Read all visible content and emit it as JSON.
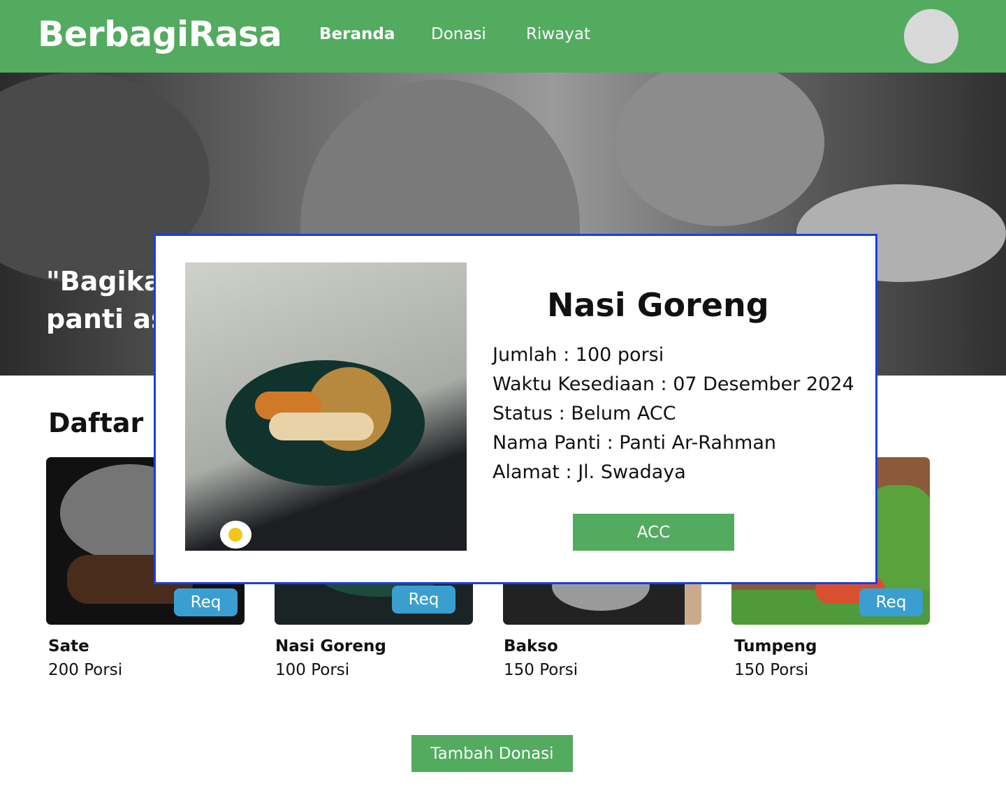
{
  "navbar": {
    "brand": "BerbagiRasa",
    "links": [
      {
        "label": "Beranda",
        "active": true
      },
      {
        "label": "Donasi",
        "active": false
      },
      {
        "label": "Riwayat",
        "active": false
      }
    ]
  },
  "hero": {
    "line1": "\"Bagika",
    "line2": "panti as"
  },
  "section": {
    "title": "Daftar M"
  },
  "cards": [
    {
      "name": "Sate",
      "qty": "200 Porsi",
      "button": "Req"
    },
    {
      "name": "Nasi Goreng",
      "qty": "100 Porsi",
      "button": "Req"
    },
    {
      "name": "Bakso",
      "qty": "150 Porsi",
      "button": ""
    },
    {
      "name": "Tumpeng",
      "qty": "150 Porsi",
      "button": "Req"
    }
  ],
  "add_button": "Tambah Donasi",
  "modal": {
    "title": "Nasi Goreng",
    "details": [
      "Jumlah  :  100 porsi",
      "Waktu Kesediaan : 07 Desember 2024",
      "Status : Belum ACC",
      "Nama Panti : Panti Ar-Rahman",
      "Alamat : Jl. Swadaya"
    ],
    "acc_button": "ACC"
  },
  "colors": {
    "primary": "#53ab5f",
    "req": "#3a9fd0",
    "modal_border": "#1a3fe0"
  }
}
